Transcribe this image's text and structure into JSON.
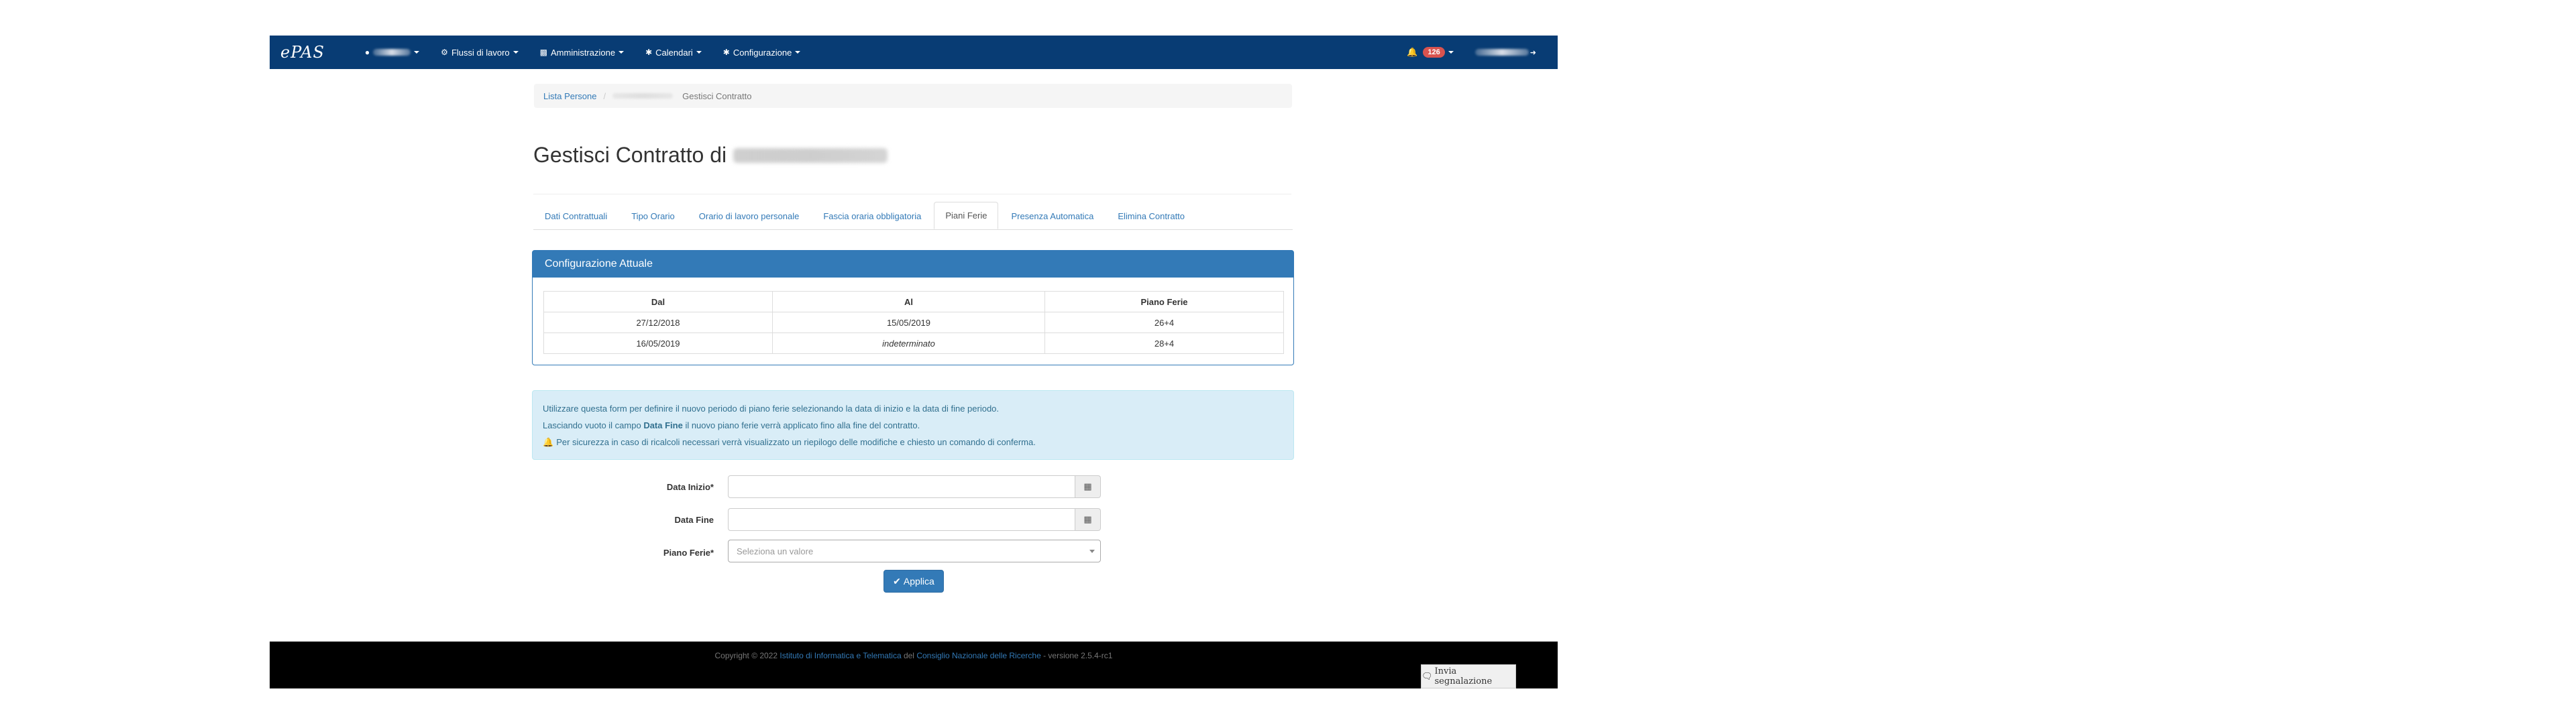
{
  "navbar": {
    "brand": "ePAS",
    "menus": [
      {
        "label": "Flussi di lavoro",
        "icon": "cog-icon"
      },
      {
        "label": "Amministrazione",
        "icon": "bar-chart-icon"
      },
      {
        "label": "Calendari",
        "icon": "gear-icon"
      },
      {
        "label": "Configurazione",
        "icon": "gear-icon"
      }
    ],
    "notification_count": "126"
  },
  "breadcrumb": {
    "root": "Lista Persone",
    "current": "Gestisci Contratto"
  },
  "page": {
    "title": "Gestisci Contratto di"
  },
  "tabs": [
    {
      "label": "Dati Contrattuali",
      "active": false
    },
    {
      "label": "Tipo Orario",
      "active": false
    },
    {
      "label": "Orario di lavoro personale",
      "active": false
    },
    {
      "label": "Fascia oraria obbligatoria",
      "active": false
    },
    {
      "label": "Piani Ferie",
      "active": true
    },
    {
      "label": "Presenza Automatica",
      "active": false
    },
    {
      "label": "Elimina Contratto",
      "active": false
    }
  ],
  "config_panel": {
    "heading": "Configurazione Attuale",
    "columns": [
      "Dal",
      "Al",
      "Piano Ferie"
    ],
    "rows": [
      [
        "27/12/2018",
        "15/05/2019",
        "26+4"
      ],
      [
        "16/05/2019",
        "indeterminato",
        "28+4"
      ]
    ]
  },
  "alert": {
    "line1": "Utilizzare questa form per definire il nuovo periodo di piano ferie selezionando la data di inizio e la data di fine periodo.",
    "line2_pre": "Lasciando vuoto il campo ",
    "line2_bold": "Data Fine",
    "line2_post": " il nuovo piano ferie verrà applicato fino alla fine del contratto.",
    "line3": "Per sicurezza in caso di ricalcoli necessari verrà visualizzato un riepilogo delle modifiche e chiesto un comando di conferma."
  },
  "form": {
    "start_label": "Data Inizio*",
    "end_label": "Data Fine",
    "plan_label": "Piano Ferie*",
    "plan_placeholder": "Seleziona un valore",
    "apply_label": "Applica"
  },
  "footer": {
    "copyright": "Copyright © 2022 ",
    "institute": "Istituto di Informatica e Telematica",
    "del": " del ",
    "council": "Consiglio Nazionale delle Ricerche",
    "version": " - versione 2.5.4-rc1",
    "report_label": "Invia segnalazione"
  }
}
